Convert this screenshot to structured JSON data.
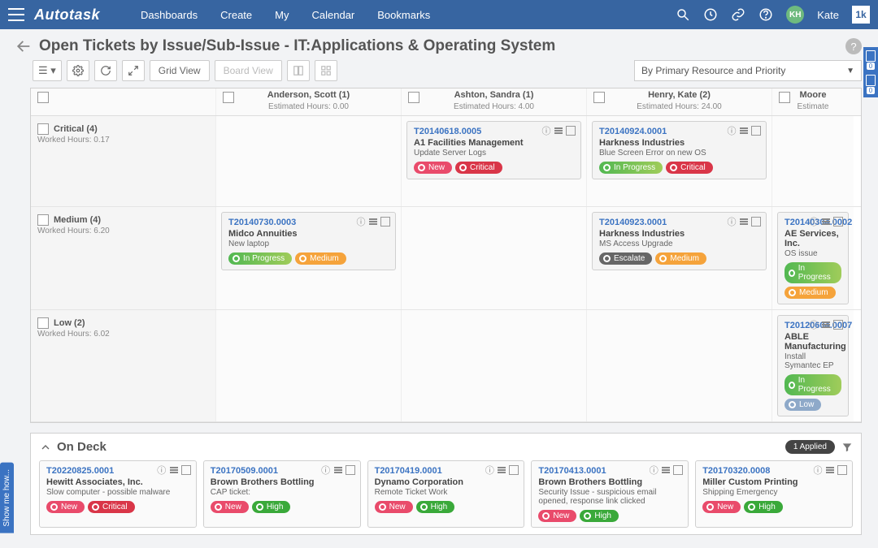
{
  "nav": {
    "logo": "Autotask",
    "items": [
      "Dashboards",
      "Create",
      "My",
      "Calendar",
      "Bookmarks"
    ],
    "user_initials": "KH",
    "user_name": "Kate",
    "corner": "1k"
  },
  "page": {
    "title": "Open Tickets by Issue/Sub-Issue - IT:Applications & Operating System"
  },
  "toolbar": {
    "grid": "Grid View",
    "board": "Board View",
    "group_by": "By Primary Resource and Priority"
  },
  "side_panel": {
    "show_me": "Show me how...",
    "right_counts": [
      "0",
      "0"
    ]
  },
  "columns": [
    {
      "name": "Anderson, Scott (1)",
      "est": "Estimated Hours: 0.00"
    },
    {
      "name": "Ashton, Sandra (1)",
      "est": "Estimated Hours: 4.00"
    },
    {
      "name": "Henry, Kate (2)",
      "est": "Estimated Hours: 24.00"
    },
    {
      "name": "Moore",
      "est": "Estimate"
    }
  ],
  "rows": [
    {
      "label": "Critical (4)",
      "wh": "Worked Hours: 0.17",
      "cells": [
        null,
        {
          "num": "T20140618.0005",
          "acct": "A1 Facilities Management",
          "desc": "Update Server Logs",
          "pills": [
            [
              "p-new",
              "New"
            ],
            [
              "p-critical",
              "Critical"
            ]
          ]
        },
        {
          "num": "T20140924.0001",
          "acct": "Harkness Industries",
          "desc": "Blue Screen Error on new OS",
          "pills": [
            [
              "p-inprogress",
              "In Progress"
            ],
            [
              "p-critical",
              "Critical"
            ]
          ]
        },
        null
      ]
    },
    {
      "label": "Medium (4)",
      "wh": "Worked Hours: 6.20",
      "cells": [
        {
          "num": "T20140730.0003",
          "acct": "Midco Annuities",
          "desc": "New laptop",
          "pills": [
            [
              "p-inprogress",
              "In Progress"
            ],
            [
              "p-medium",
              "Medium"
            ]
          ]
        },
        null,
        {
          "num": "T20140923.0001",
          "acct": "Harkness Industries",
          "desc": "MS Access Upgrade",
          "pills": [
            [
              "p-escalate",
              "Escalate"
            ],
            [
              "p-medium",
              "Medium"
            ]
          ]
        },
        {
          "num": "T20140304.0002",
          "acct": "AE Services, Inc.",
          "desc": "OS issue",
          "pills": [
            [
              "p-inprogress",
              "In Progress"
            ],
            [
              "p-medium",
              "Medium"
            ]
          ]
        }
      ]
    },
    {
      "label": "Low (2)",
      "wh": "Worked Hours: 6.02",
      "cells": [
        null,
        null,
        null,
        {
          "num": "T20120604.0007",
          "acct": "ABLE Manufacturing",
          "desc": "Install Symantec EP",
          "pills": [
            [
              "p-inprogress",
              "In Progress"
            ],
            [
              "p-low",
              "Low"
            ]
          ]
        }
      ]
    }
  ],
  "ondeck": {
    "title": "On Deck",
    "applied": "1 Applied",
    "cards": [
      {
        "num": "T20220825.0001",
        "acct": "Hewitt Associates, Inc.",
        "desc": "Slow computer - possible malware",
        "pills": [
          [
            "p-new",
            "New"
          ],
          [
            "p-critical",
            "Critical"
          ]
        ]
      },
      {
        "num": "T20170509.0001",
        "acct": "Brown Brothers Bottling",
        "desc": "CAP ticket:",
        "pills": [
          [
            "p-new",
            "New"
          ],
          [
            "p-high",
            "High"
          ]
        ]
      },
      {
        "num": "T20170419.0001",
        "acct": "Dynamo Corporation",
        "desc": "Remote Ticket Work",
        "pills": [
          [
            "p-new",
            "New"
          ],
          [
            "p-high",
            "High"
          ]
        ]
      },
      {
        "num": "T20170413.0001",
        "acct": "Brown Brothers Bottling",
        "desc": "Security Issue - suspicious email opened, response link clicked",
        "pills": [
          [
            "p-new",
            "New"
          ],
          [
            "p-high",
            "High"
          ]
        ]
      },
      {
        "num": "T20170320.0008",
        "acct": "Miller Custom Printing",
        "desc": "Shipping Emergency",
        "pills": [
          [
            "p-new",
            "New"
          ],
          [
            "p-high",
            "High"
          ]
        ]
      }
    ]
  }
}
